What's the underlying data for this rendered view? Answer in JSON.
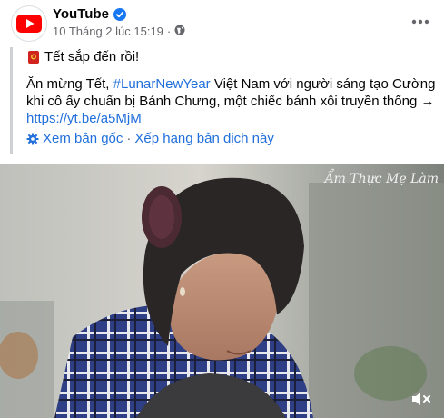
{
  "post": {
    "page_name": "YouTube",
    "timestamp": "10 Tháng 2 lúc 15:19",
    "privacy_icon": "globe-icon",
    "more_icon": "more-horizontal-icon"
  },
  "content": {
    "line1": "Tết sắp đến rồi!",
    "body_prefix": "Ăn mừng Tết, ",
    "hashtag": "#LunarNewYear",
    "body_main": " Việt Nam với người sáng tạo Cường khi cô ấy chuẩn bị Bánh Chưng, một chiếc bánh xôi truyền thống → ",
    "link": "https://yt.be/a5MjM"
  },
  "actions": {
    "see_original": "Xem bản gốc",
    "separator": "·",
    "rate_translation": "Xếp hạng bản dịch này"
  },
  "video": {
    "watermark": "Ẩm Thực Mẹ Làm"
  },
  "colors": {
    "youtube_red": "#ff0000",
    "link_blue": "#216fdb",
    "verified_blue": "#1877f2",
    "muted_text": "#65676b"
  }
}
